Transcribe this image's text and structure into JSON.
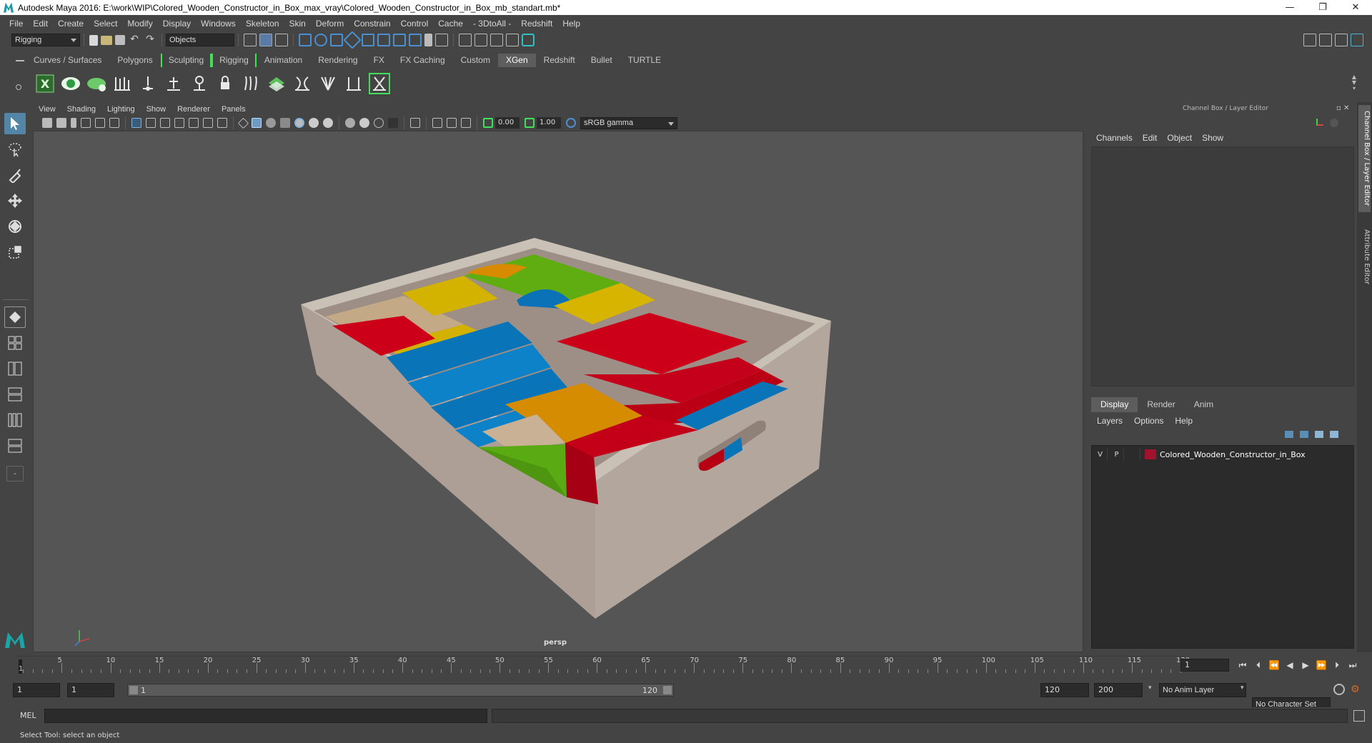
{
  "window": {
    "title": "Autodesk Maya 2016: E:\\work\\WIP\\Colored_Wooden_Constructor_in_Box_max_vray\\Colored_Wooden_Constructor_in_Box_mb_standart.mb*",
    "minimize": "—",
    "restore": "❐",
    "close": "✕"
  },
  "menubar": [
    "File",
    "Edit",
    "Create",
    "Select",
    "Modify",
    "Display",
    "Windows",
    "Skeleton",
    "Skin",
    "Deform",
    "Constrain",
    "Control",
    "Cache",
    "- 3DtoAll -",
    "Redshift",
    "Help"
  ],
  "statusline": {
    "menuset": "Rigging",
    "select_mode": "Objects"
  },
  "shelf_tabs": [
    {
      "label": "Curves / Surfaces",
      "active": false
    },
    {
      "label": "Polygons",
      "active": false
    },
    {
      "label": "Sculpting",
      "active": false,
      "bracket": true
    },
    {
      "label": "Rigging",
      "active": false,
      "bracket": true
    },
    {
      "label": "Animation",
      "active": false
    },
    {
      "label": "Rendering",
      "active": false
    },
    {
      "label": "FX",
      "active": false
    },
    {
      "label": "FX Caching",
      "active": false
    },
    {
      "label": "Custom",
      "active": false
    },
    {
      "label": "XGen",
      "active": true
    },
    {
      "label": "Redshift",
      "active": false
    },
    {
      "label": "Bullet",
      "active": false
    },
    {
      "label": "TURTLE",
      "active": false
    }
  ],
  "viewport": {
    "menu": [
      "View",
      "Shading",
      "Lighting",
      "Show",
      "Renderer",
      "Panels"
    ],
    "exposure": "0.00",
    "gamma": "1.00",
    "color_space": "sRGB gamma",
    "camera": "persp"
  },
  "channel_box": {
    "header": "Channel Box / Layer Editor",
    "menu": [
      "Channels",
      "Edit",
      "Object",
      "Show"
    ]
  },
  "layer_editor": {
    "tabs": [
      {
        "label": "Display",
        "active": true
      },
      {
        "label": "Render",
        "active": false
      },
      {
        "label": "Anim",
        "active": false
      }
    ],
    "menu": [
      "Layers",
      "Options",
      "Help"
    ],
    "layers": [
      {
        "visible": "V",
        "playback": "P",
        "name": "Colored_Wooden_Constructor_in_Box",
        "color": "#a2122d"
      }
    ]
  },
  "side_tabs": [
    "Channel Box / Layer Editor",
    "Attribute Editor"
  ],
  "time_slider": {
    "ticks": [
      "5",
      "10",
      "15",
      "20",
      "25",
      "30",
      "35",
      "40",
      "45",
      "50",
      "55",
      "60",
      "65",
      "70",
      "75",
      "80",
      "85",
      "90",
      "95",
      "100",
      "105",
      "110",
      "115",
      "120"
    ],
    "start_label": "1",
    "current_frame": "1"
  },
  "range_slider": {
    "start": "1",
    "anim_start": "1",
    "range_start": "1",
    "range_end": "120",
    "anim_end": "120",
    "end": "200",
    "anim_layer": "No Anim Layer",
    "character_set": "No Character Set"
  },
  "command_line": {
    "language": "MEL"
  },
  "help_line": "Select Tool: select an object",
  "colors": {
    "accent": "#5d5d5d",
    "bracket_green": "#42e05a",
    "box_wood": "#a8a19a",
    "red": "#c4001a",
    "blue": "#0a74b8",
    "green": "#5aaa14",
    "yellow": "#d8b400",
    "orange": "#d58c00"
  }
}
